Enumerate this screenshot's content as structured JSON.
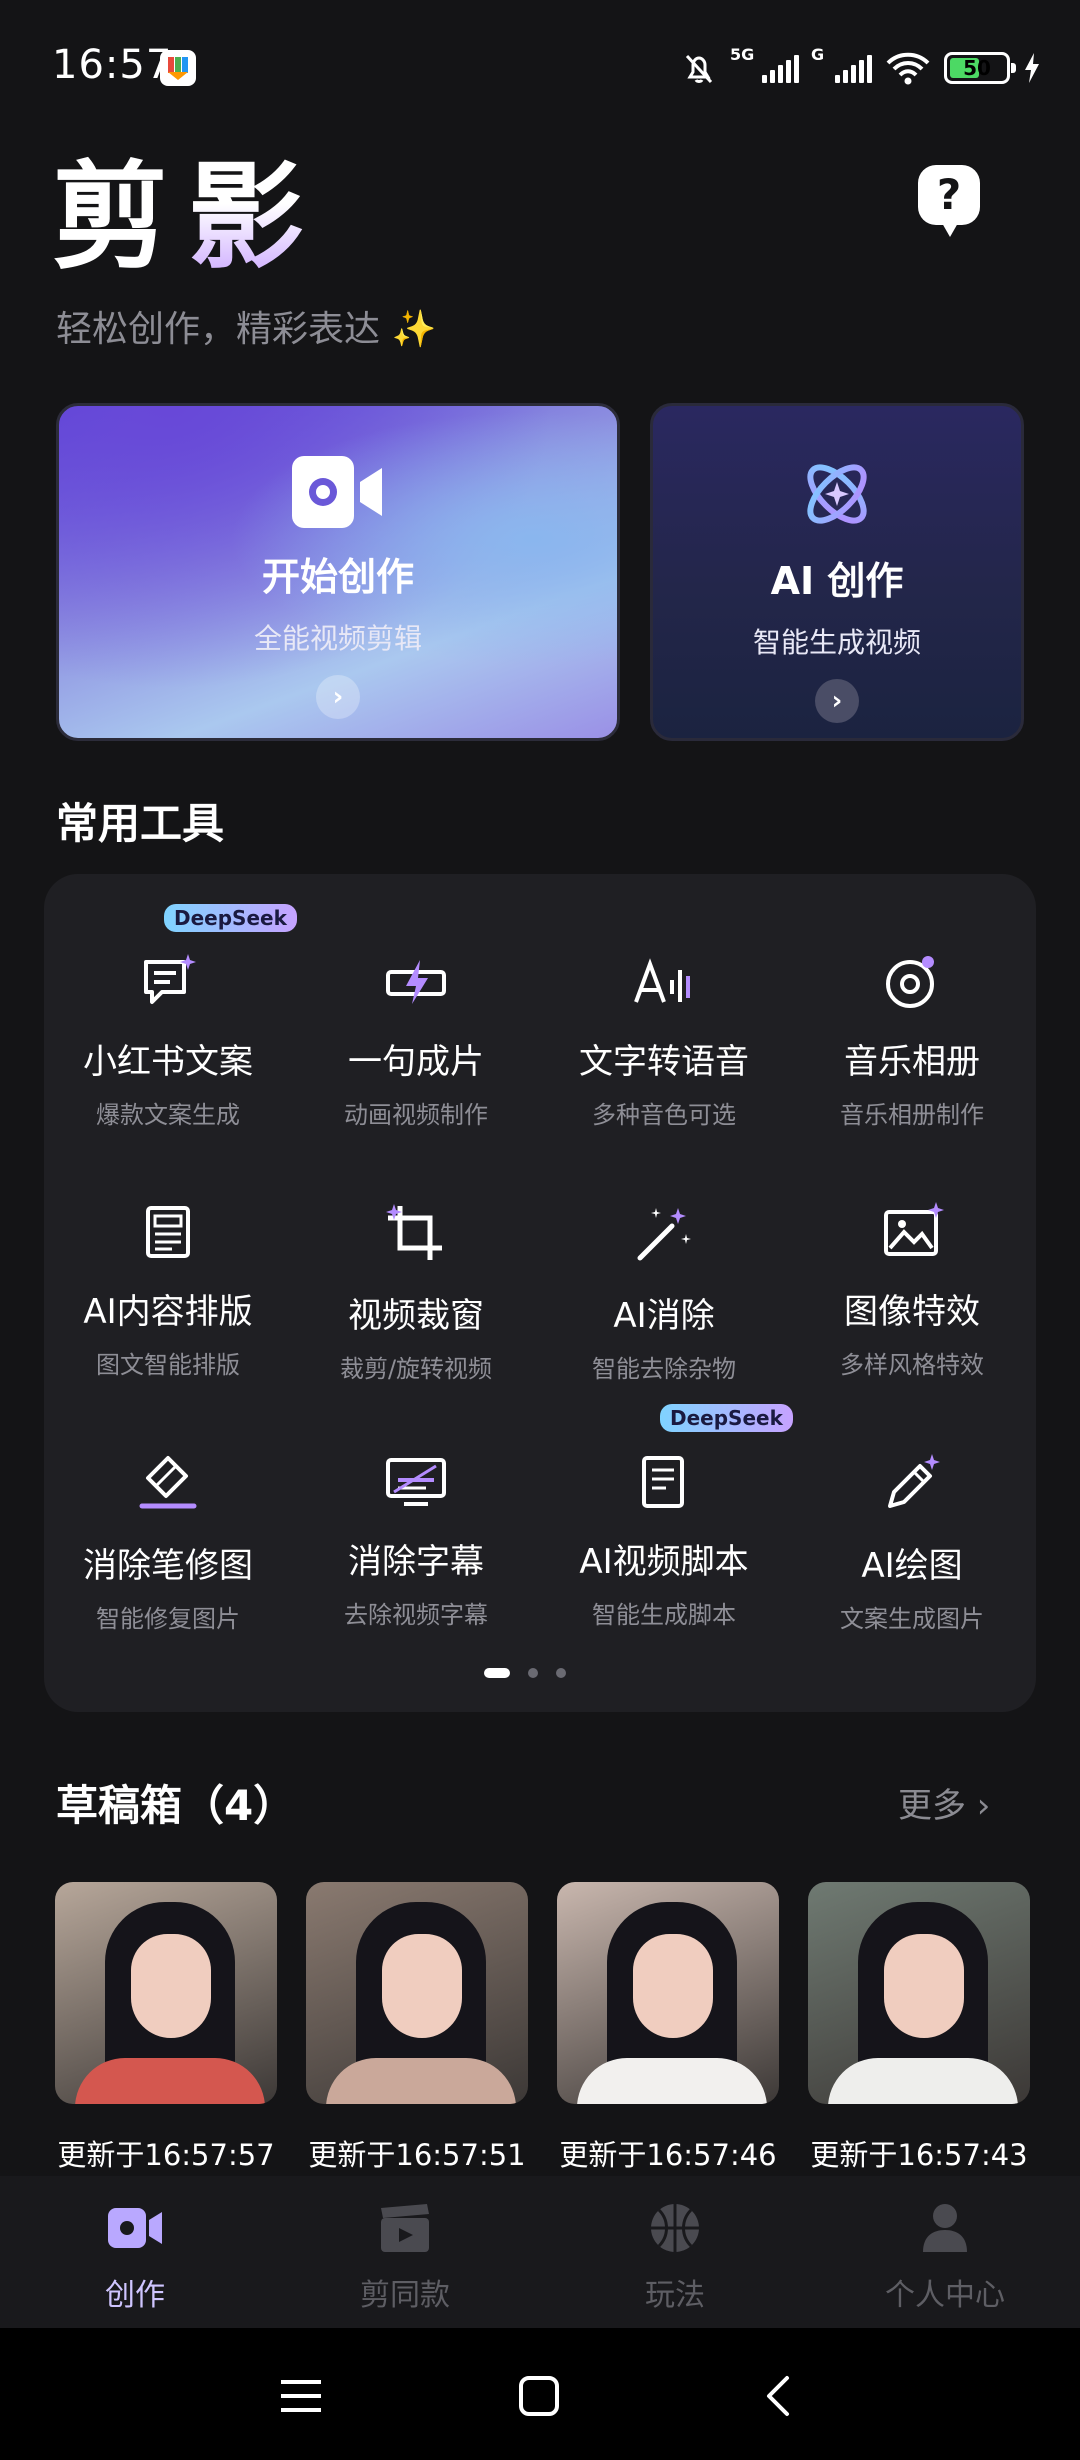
{
  "status_bar": {
    "time": "16:57",
    "network_1": "5G",
    "network_2": "G",
    "battery": "50"
  },
  "header": {
    "logo": "剪",
    "logo_accent": "影",
    "tagline": "轻松创作，精彩表达 ✨",
    "help_symbol": "?"
  },
  "hero": {
    "create": {
      "title": "开始创作",
      "subtitle": "全能视频剪辑",
      "arrow": "›"
    },
    "ai": {
      "title": "AI 创作",
      "subtitle": "智能生成视频",
      "arrow": "›"
    }
  },
  "tools": {
    "section_title": "常用工具",
    "items": [
      {
        "name": "小红书文案",
        "desc": "爆款文案生成",
        "icon": "chat-doc-icon",
        "tag": "DeepSeek"
      },
      {
        "name": "一句成片",
        "desc": "动画视频制作",
        "icon": "lightning-film-icon"
      },
      {
        "name": "文字转语音",
        "desc": "多种音色可选",
        "icon": "text-to-speech-icon"
      },
      {
        "name": "音乐相册",
        "desc": "音乐相册制作",
        "icon": "music-disc-icon"
      },
      {
        "name": "AI内容排版",
        "desc": "图文智能排版",
        "icon": "layout-doc-icon"
      },
      {
        "name": "视频裁窗",
        "desc": "裁剪/旋转视频",
        "icon": "crop-icon"
      },
      {
        "name": "AI消除",
        "desc": "智能去除杂物",
        "icon": "magic-wand-icon"
      },
      {
        "name": "图像特效",
        "desc": "多样风格特效",
        "icon": "image-effect-icon"
      },
      {
        "name": "消除笔修图",
        "desc": "智能修复图片",
        "icon": "eraser-icon"
      },
      {
        "name": "消除字幕",
        "desc": "去除视频字幕",
        "icon": "remove-subtitle-icon"
      },
      {
        "name": "AI视频脚本",
        "desc": "智能生成脚本",
        "icon": "script-doc-icon",
        "tag": "DeepSeek"
      },
      {
        "name": "AI绘图",
        "desc": "文案生成图片",
        "icon": "pencil-sparkle-icon"
      }
    ],
    "page_count": 3,
    "active_page": 1
  },
  "drafts": {
    "title": "草稿箱（4）",
    "more": "更多  ›",
    "items": [
      {
        "time": "更新于16:57:57",
        "tone": "#b7a79a",
        "shirt": "#d4574f"
      },
      {
        "time": "更新于16:57:51",
        "tone": "#8a7a70",
        "shirt": "#caa89a"
      },
      {
        "time": "更新于16:57:46",
        "tone": "#c9b7ae",
        "shirt": "#f2f0ee"
      },
      {
        "time": "更新于16:57:43",
        "tone": "#6f7a72",
        "shirt": "#eeeeec"
      }
    ]
  },
  "bottom_nav": {
    "items": [
      {
        "label": "创作",
        "icon": "video-camera-icon",
        "active": true
      },
      {
        "label": "剪同款",
        "icon": "clapper-icon"
      },
      {
        "label": "玩法",
        "icon": "basketball-icon"
      },
      {
        "label": "个人中心",
        "icon": "person-icon"
      }
    ]
  },
  "colors": {
    "background": "#141416",
    "panel": "#1f1f23",
    "accent": "#a996ff",
    "tag_gradient_start": "#7fd3ff",
    "tag_gradient_end": "#c6a2ff"
  }
}
